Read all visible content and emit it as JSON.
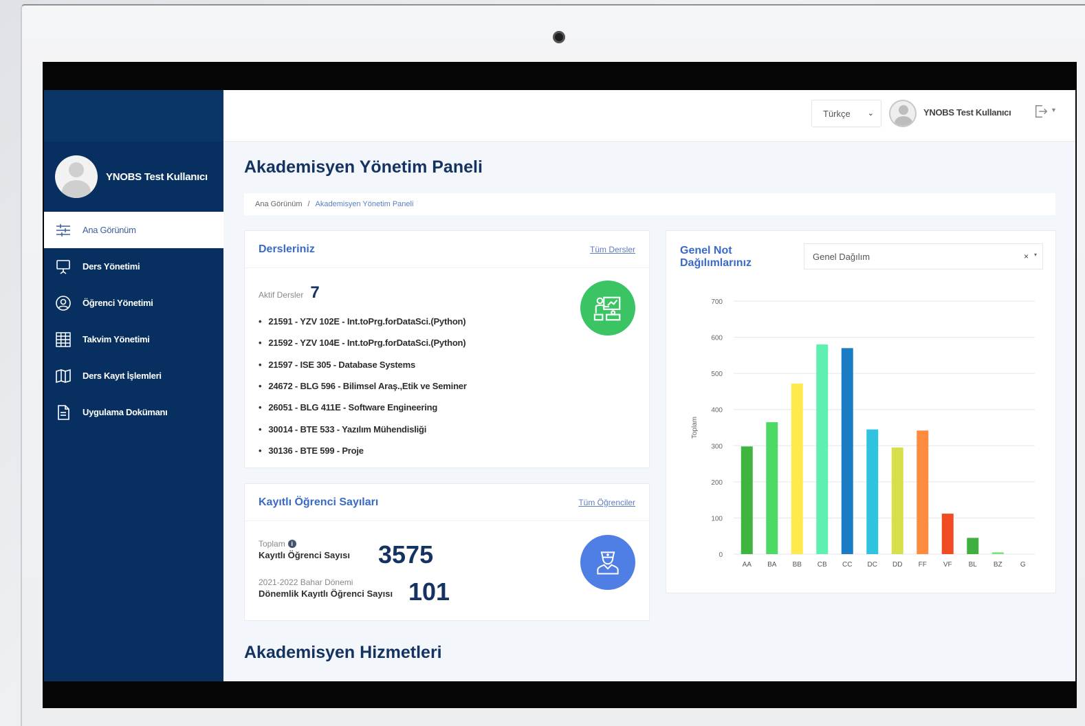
{
  "topbar": {
    "language": "Türkçe",
    "username": "YNOBS Test Kullanıcı"
  },
  "sidebar": {
    "username": "YNOBS Test Kullanıcı",
    "items": [
      {
        "label": "Ana Görünüm",
        "icon": "sliders-icon",
        "active": true
      },
      {
        "label": "Ders Yönetimi",
        "icon": "presentation-board-icon"
      },
      {
        "label": "Öğrenci Yönetimi",
        "icon": "user-circle-icon"
      },
      {
        "label": "Takvim Yönetimi",
        "icon": "calendar-grid-icon"
      },
      {
        "label": "Ders Kayıt İşlemleri",
        "icon": "open-book-icon"
      },
      {
        "label": "Uygulama Dokümanı",
        "icon": "document-icon"
      }
    ]
  },
  "page": {
    "title": "Akademisyen Yönetim Paneli",
    "breadcrumb": {
      "home": "Ana Görünüm",
      "separator": "/",
      "current": "Akademisyen Yönetim Paneli"
    },
    "section_title": "Akademisyen Hizmetleri"
  },
  "courses": {
    "title": "Dersleriniz",
    "link": "Tüm Dersler",
    "active_label": "Aktif Dersler",
    "active_count": "7",
    "list": [
      "21591 - YZV 102E - Int.toPrg.forDataSci.(Python)",
      "21592 - YZV 104E - Int.toPrg.forDataSci.(Python)",
      "21597 - ISE 305 - Database Systems",
      "24672 - BLG 596 - Bilimsel Araş.,Etik ve Seminer",
      "26051 - BLG 411E - Software Engineering",
      "30014 - BTE 533 - Yazılım Mühendisliği",
      "30136 - BTE 599 - Proje"
    ]
  },
  "students": {
    "title": "Kayıtlı Öğrenci Sayıları",
    "link": "Tüm Öğrenciler",
    "total_small": "Toplam",
    "total_label": "Kayıtlı Öğrenci Sayısı",
    "total_value": "3575",
    "term_small": "2021-2022 Bahar Dönemi",
    "term_label": "Dönemlik Kayıtlı Öğrenci Sayısı",
    "term_value": "101"
  },
  "grades": {
    "title": "Genel Not Dağılımlarınız",
    "select_value": "Genel Dağılım",
    "clear_symbol": "×",
    "caret_symbol": "▾"
  },
  "chart_data": {
    "type": "bar",
    "ylabel": "Toplam",
    "ylim": [
      0,
      700
    ],
    "yticks": [
      0,
      100,
      200,
      300,
      400,
      500,
      600,
      700
    ],
    "grid": true,
    "categories": [
      "AA",
      "BA",
      "BB",
      "CB",
      "CC",
      "DC",
      "DD",
      "FF",
      "VF",
      "BL",
      "BZ",
      "G"
    ],
    "values": [
      298,
      365,
      472,
      580,
      570,
      345,
      295,
      342,
      112,
      45,
      5,
      0
    ],
    "colors": [
      "#3eb53e",
      "#4cd964",
      "#ffe94d",
      "#5df0b0",
      "#1a7dc4",
      "#30c3e0",
      "#d7e04a",
      "#ff8c3e",
      "#f04b23",
      "#3fb03f",
      "#7ae37a",
      "#7ae37a"
    ]
  }
}
